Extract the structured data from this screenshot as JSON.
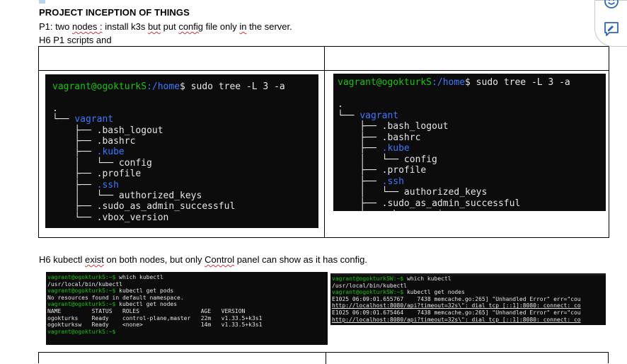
{
  "doc": {
    "title": "PROJECT INCEPTION OF THINGS",
    "line1": {
      "p1": "P1: two ",
      "nodes": "nodes",
      "colon": " :",
      "p2": " install k3s ",
      "but": "but",
      "p3": " put ",
      "config": "config",
      "p4": " file only ",
      "in": "in",
      "p5": " the server."
    },
    "line2": "H6 P1  scripts and",
    "line3": {
      "p1": "H6  kubectl ",
      "exist": "exist",
      "p2": " on both nodes, but only ",
      "control": "Control",
      "p3": " panel can show as it has config."
    }
  },
  "term1": {
    "user": "vagrant@ogokturkS",
    "path": ":/home",
    "cmd": "$ sudo tree -L 3 -a",
    "tree": [
      {
        "text": "└── ",
        "name": "vagrant",
        "dir": true
      },
      {
        "text": "    ├── ",
        "name": ".bash_logout",
        "dir": false
      },
      {
        "text": "    ├── ",
        "name": ".bashrc",
        "dir": false
      },
      {
        "text": "    ├── ",
        "name": ".kube",
        "dir": true
      },
      {
        "text": "    │   └── ",
        "name": "config",
        "dir": false
      },
      {
        "text": "    ├── ",
        "name": ".profile",
        "dir": false
      },
      {
        "text": "    ├── ",
        "name": ".ssh",
        "dir": true
      },
      {
        "text": "    │   └── ",
        "name": "authorized_keys",
        "dir": false
      },
      {
        "text": "    ├── ",
        "name": ".sudo_as_admin_successful",
        "dir": false
      },
      {
        "text": "    └── ",
        "name": ".vbox_version",
        "dir": false
      }
    ]
  },
  "term2": {
    "user": "vagrant@ogokturkS",
    "path": ":/home",
    "cmd": "$ sudo tree -L 3 -a",
    "tree": [
      {
        "text": "└── ",
        "name": "vagrant",
        "dir": true
      },
      {
        "text": "    ├── ",
        "name": ".bash_logout",
        "dir": false
      },
      {
        "text": "    ├── ",
        "name": ".bashrc",
        "dir": false
      },
      {
        "text": "    ├── ",
        "name": ".kube",
        "dir": true
      },
      {
        "text": "    │   └── ",
        "name": "config",
        "dir": false
      },
      {
        "text": "    ├── ",
        "name": ".profile",
        "dir": false
      },
      {
        "text": "    ├── ",
        "name": ".ssh",
        "dir": true
      },
      {
        "text": "    │   └── ",
        "name": "authorized_keys",
        "dir": false
      },
      {
        "text": "    ├── ",
        "name": ".sudo_as_admin_successful",
        "dir": false
      },
      {
        "text": "    └── ",
        "name": ".vbox_version",
        "dir": false
      }
    ]
  },
  "term3": {
    "l1_prompt": "vagrant@ogokturkS:~$",
    "l1_cmd": " which kubectl",
    "l2": "/usr/local/bin/kubectl",
    "l3_prompt": "vagrant@ogokturkS:~$",
    "l3_cmd": " kubectl get pods",
    "l4": "No resources found in default namespace.",
    "l5_prompt": "vagrant@ogokturkS:~$",
    "l5_cmd": " kubectl get nodes",
    "header": "NAME         STATUS   ROLES                  AGE   VERSION",
    "row1": "ogokturks    Ready    control-plane,master   22m   v1.33.5+k3s1",
    "row2": "ogokturksw   Ready    <none>                 14m   v1.33.5+k3s1",
    "l8_prompt": "vagrant@ogokturkS:~$"
  },
  "term4": {
    "l1_prompt": "vagrant@ogokturkSW:~$",
    "l1_cmd": " which kubectl",
    "l2": "/usr/local/bin/kubectl",
    "l3_prompt": "vagrant@ogokturkSW:~$",
    "l3_cmd": " kubectl get nodes",
    "l4": "E1025 06:09:01.655767    7438 memcache.go:265] \"Unhandled Error\" err=\"cou",
    "l5": "http://localhost:8080/api?timeout=32s\\\": dial tcp [::1]:8080: connect: co",
    "l6": "E1025 06:09:01.675464    7438 memcache.go:265] \"Unhandled Error\" err=\"cou",
    "l7": "http://localhost:8080/api?timeout=32s\\\": dial tcp [::1]:8080: connect: co"
  },
  "colors": {
    "prompt_user": "#16c60c",
    "prompt_path": "#3b78ff",
    "terminal_bg": "#0c0c0c",
    "side_icon": "#2b66c6"
  },
  "side_icons": [
    "smiley-feedback-icon",
    "comment-add-icon"
  ]
}
